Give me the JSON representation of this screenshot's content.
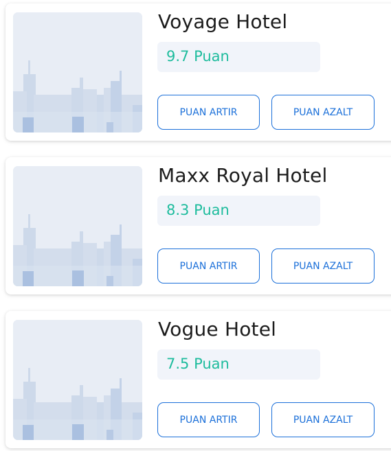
{
  "hotels": [
    {
      "name": "Voyage Hotel",
      "score": "9.7 Puan"
    },
    {
      "name": "Maxx Royal Hotel",
      "score": "8.3 Puan"
    },
    {
      "name": "Vogue Hotel",
      "score": "7.5 Puan"
    }
  ],
  "buttons": {
    "increase_label": "PUAN ARTIR",
    "decrease_label": "PUAN AZALT"
  },
  "colors": {
    "score_text": "#1ebc9d",
    "button_accent": "#1a6fd9",
    "score_background": "#f1f4fa"
  },
  "icons": {
    "thumbnail": "city-skyline-placeholder"
  }
}
